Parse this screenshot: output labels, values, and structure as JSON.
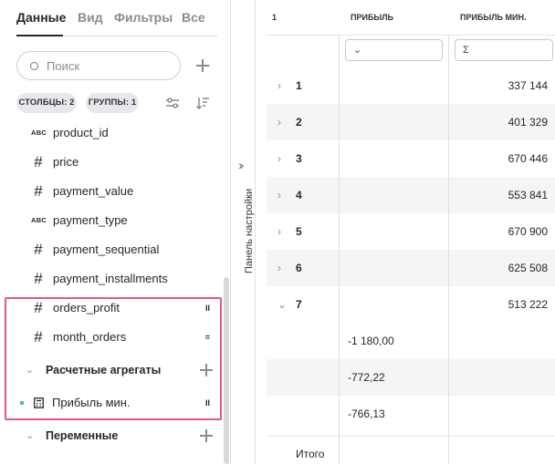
{
  "tabs": [
    {
      "label": "Данные",
      "active": true
    },
    {
      "label": "Вид",
      "active": false
    },
    {
      "label": "Фильтры",
      "active": false
    },
    {
      "label": "Все",
      "active": false
    }
  ],
  "search": {
    "placeholder": "Поиск"
  },
  "chips": {
    "columns": "СТОЛБЦЫ: 2",
    "groups": "ГРУППЫ: 1"
  },
  "fields": [
    {
      "type_icon": "ABC",
      "name": "product_id",
      "mark": ""
    },
    {
      "type_icon": "#",
      "name": "price",
      "mark": ""
    },
    {
      "type_icon": "#",
      "name": "payment_value",
      "mark": ""
    },
    {
      "type_icon": "ABC",
      "name": "payment_type",
      "mark": ""
    },
    {
      "type_icon": "#",
      "name": "payment_sequential",
      "mark": ""
    },
    {
      "type_icon": "#",
      "name": "payment_installments",
      "mark": ""
    },
    {
      "type_icon": "#",
      "name": "orders_profit",
      "mark": "II"
    },
    {
      "type_icon": "#",
      "name": "month_orders",
      "mark": "="
    }
  ],
  "groups": {
    "aggregates": "Расчетные агрегаты",
    "variables": "Переменные"
  },
  "aggregate_items": [
    {
      "name": "Прибыль мин.",
      "mark": "II",
      "color": "#5bb8b0"
    }
  ],
  "side_panel": {
    "label": "Панель настройки"
  },
  "table": {
    "headers": [
      "1",
      "ПРИБЫЛЬ",
      "ПРИБЫЛЬ МИН."
    ],
    "filter_icons": [
      "funnel",
      "sigma"
    ],
    "rows": [
      {
        "label": "1",
        "value": "337 144",
        "expanded": false
      },
      {
        "label": "2",
        "value": "401 329",
        "expanded": false
      },
      {
        "label": "3",
        "value": "670 446",
        "expanded": false
      },
      {
        "label": "4",
        "value": "553 841",
        "expanded": false
      },
      {
        "label": "5",
        "value": "670 900",
        "expanded": false
      },
      {
        "label": "6",
        "value": "625 508",
        "expanded": false
      },
      {
        "label": "7",
        "value": "513 222",
        "expanded": true
      }
    ],
    "subrows": [
      "-1 180,00",
      "-772,22",
      "-766,13"
    ],
    "total_label": "Итого"
  },
  "colors": {
    "highlight": "#e35b7f",
    "accent_marker": "#5bb8b0"
  }
}
